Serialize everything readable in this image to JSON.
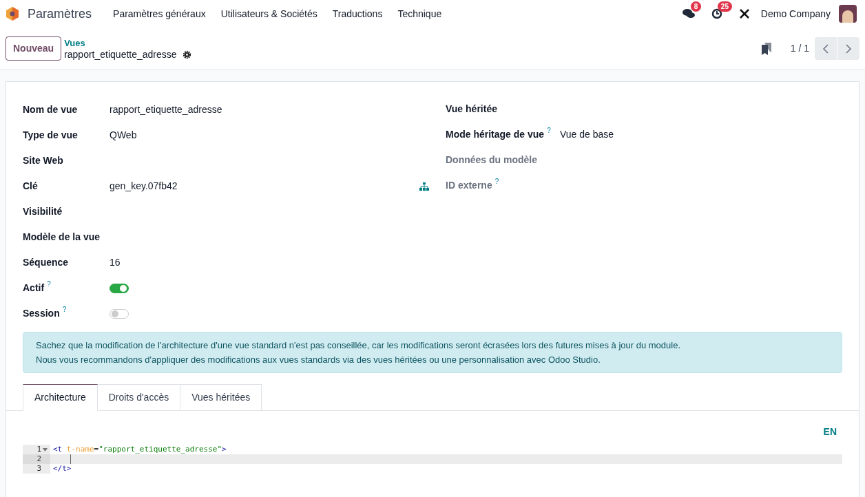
{
  "navbar": {
    "app": "Paramètres",
    "menu": [
      "Paramètres généraux",
      "Utilisateurs & Sociétés",
      "Traductions",
      "Technique"
    ],
    "messages_badge": "8",
    "activities_badge": "25",
    "company": "Demo Company"
  },
  "control": {
    "new_button": "Nouveau",
    "breadcrumb": "Vues",
    "record": "rapport_etiquette_adresse",
    "pager": "1 / 1"
  },
  "left_fields": [
    {
      "kind": "text",
      "label": "Nom de vue",
      "value": "rapport_etiquette_adresse"
    },
    {
      "kind": "text",
      "label": "Type de vue",
      "value": "QWeb"
    },
    {
      "kind": "text",
      "label": "Site Web"
    },
    {
      "kind": "link",
      "label": "Clé",
      "value": "gen_key.07fb42"
    },
    {
      "kind": "text",
      "label": "Visibilité"
    },
    {
      "kind": "text",
      "label": "Modèle de la vue"
    },
    {
      "kind": "text",
      "label": "Séquence",
      "value": "16"
    },
    {
      "kind": "toggle",
      "label": "Actif",
      "help": "?",
      "on": true
    },
    {
      "kind": "toggle",
      "label": "Session",
      "help": "?",
      "on": false
    }
  ],
  "right_fields": [
    {
      "label": "Vue héritée",
      "muted": false
    },
    {
      "label": "Mode héritage de vue",
      "help": "?",
      "value": "Vue de base",
      "muted": false
    },
    {
      "label": "Données du modèle",
      "muted": true
    },
    {
      "label": "ID externe",
      "help": "?",
      "muted": true
    }
  ],
  "alert": [
    "Sachez que la modification de l'architecture d'une vue standard n'est pas conseillée, car les modifications seront écrasées lors des futures mises à jour du module.",
    "Nous vous recommandons d'appliquer des modifications aux vues standards via des vues héritées ou une personnalisation avec Odoo Studio."
  ],
  "tabs": [
    {
      "label": "Architecture",
      "selected": true
    },
    {
      "label": "Droits d'accès",
      "selected": false
    },
    {
      "label": "Vues héritées",
      "selected": false
    }
  ],
  "editor": {
    "lang": "EN",
    "lines": [
      {
        "number": "1",
        "foldable": true,
        "active": false,
        "tokens": [
          {
            "kind": "tag",
            "text": "<t"
          },
          {
            "kind": "attr",
            "text": " t-name"
          },
          {
            "kind": "plain",
            "text": "="
          },
          {
            "kind": "string",
            "text": "\"rapport_etiquette_adresse\""
          },
          {
            "kind": "tag",
            "text": ">"
          }
        ]
      },
      {
        "number": "2",
        "foldable": false,
        "active": true
      },
      {
        "number": "3",
        "foldable": false,
        "active": false,
        "tokens": [
          {
            "kind": "tag",
            "text": "</t>"
          }
        ]
      }
    ]
  }
}
